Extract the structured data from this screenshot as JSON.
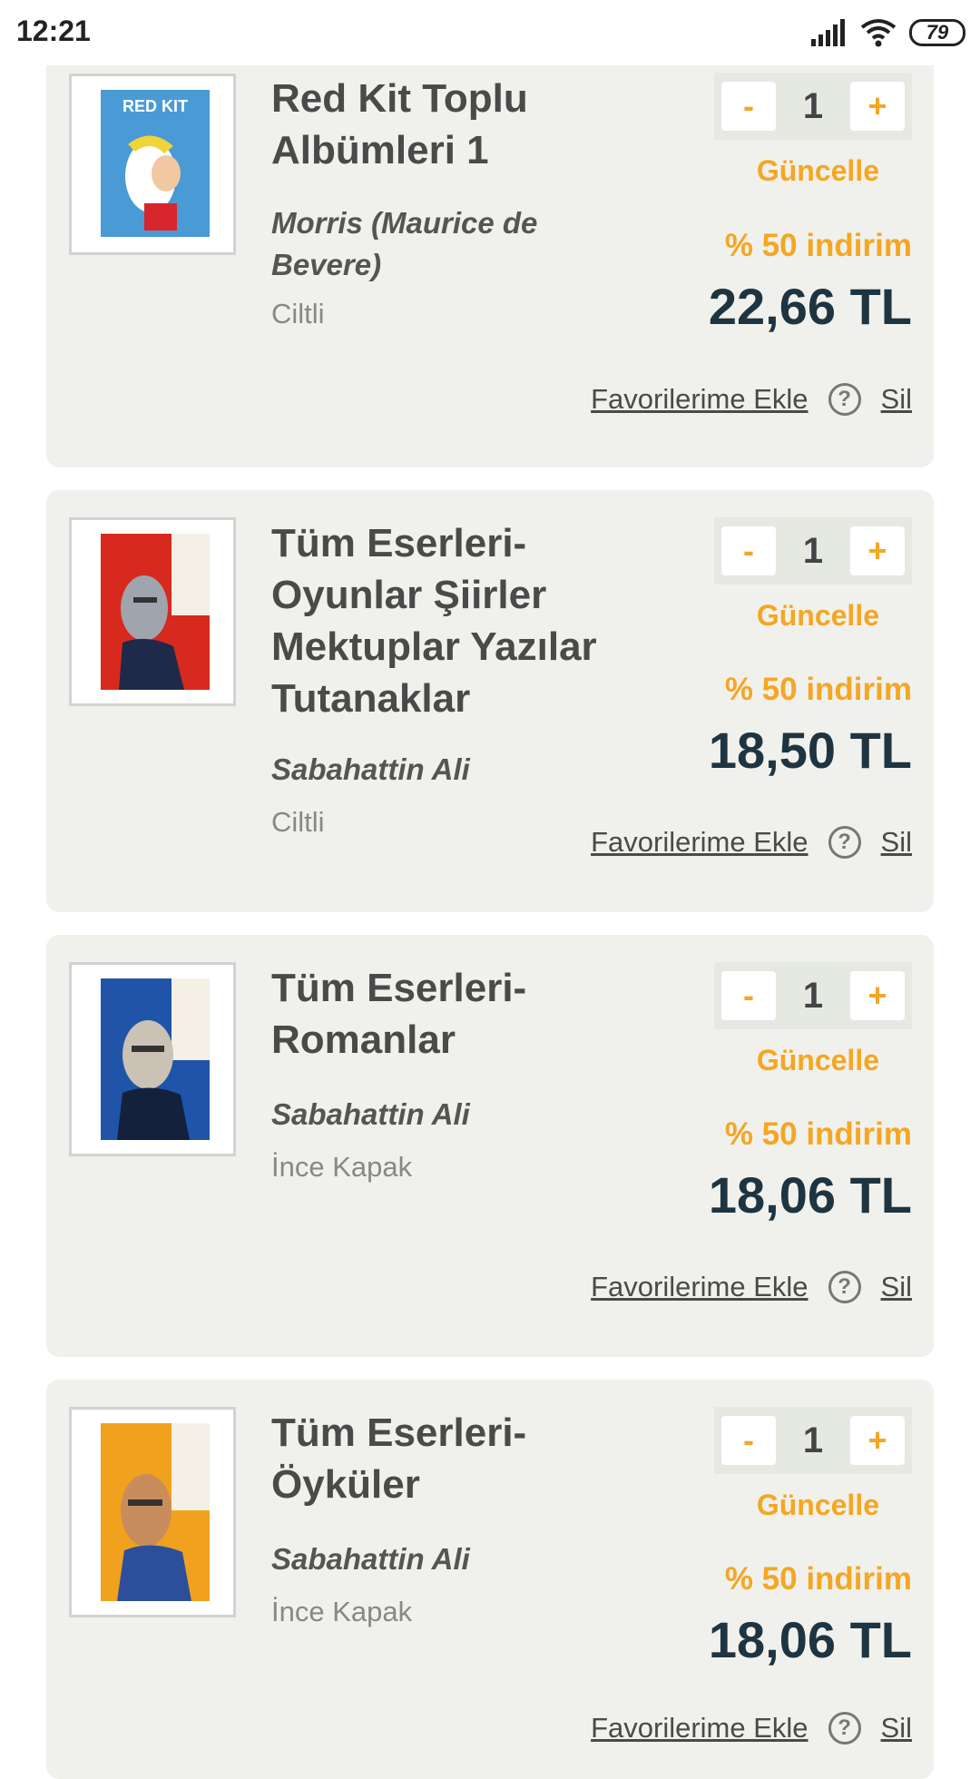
{
  "status_bar": {
    "time": "12:21",
    "battery": "79",
    "icons": [
      "signal-icon",
      "wifi-icon",
      "battery-icon"
    ]
  },
  "colors": {
    "accent": "#f5a623",
    "price": "#1f3441",
    "card_bg": "#f0f1ec"
  },
  "cart": {
    "items": [
      {
        "title": "Red Kit Toplu Albümleri 1",
        "author": "Morris (Maurice de Bevere)",
        "binding": "Ciltli",
        "quantity": "1",
        "minus_label": "-",
        "plus_label": "+",
        "update_label": "Güncelle",
        "discount": "% 50 indirim",
        "price": "22,66 TL",
        "favorite_label": "Favorilerime Ekle",
        "delete_label": "Sil",
        "help_glyph": "?",
        "cover_text": "RED KIT"
      },
      {
        "title": "Tüm Eserleri-Oyunlar Şiirler Mektuplar Yazılar Tutanaklar",
        "author": "Sabahattin Ali",
        "binding": "Ciltli",
        "quantity": "1",
        "minus_label": "-",
        "plus_label": "+",
        "update_label": "Güncelle",
        "discount": "% 50 indirim",
        "price": "18,50 TL",
        "favorite_label": "Favorilerime Ekle",
        "delete_label": "Sil",
        "help_glyph": "?"
      },
      {
        "title": "Tüm Eserleri-Romanlar",
        "author": "Sabahattin Ali",
        "binding": "İnce Kapak",
        "quantity": "1",
        "minus_label": "-",
        "plus_label": "+",
        "update_label": "Güncelle",
        "discount": "% 50 indirim",
        "price": "18,06 TL",
        "favorite_label": "Favorilerime Ekle",
        "delete_label": "Sil",
        "help_glyph": "?"
      },
      {
        "title": "Tüm Eserleri-Öyküler",
        "author": "Sabahattin Ali",
        "binding": "İnce Kapak",
        "quantity": "1",
        "minus_label": "-",
        "plus_label": "+",
        "update_label": "Güncelle",
        "discount": "% 50 indirim",
        "price": "18,06 TL",
        "favorite_label": "Favorilerime Ekle",
        "delete_label": "Sil",
        "help_glyph": "?"
      }
    ]
  }
}
